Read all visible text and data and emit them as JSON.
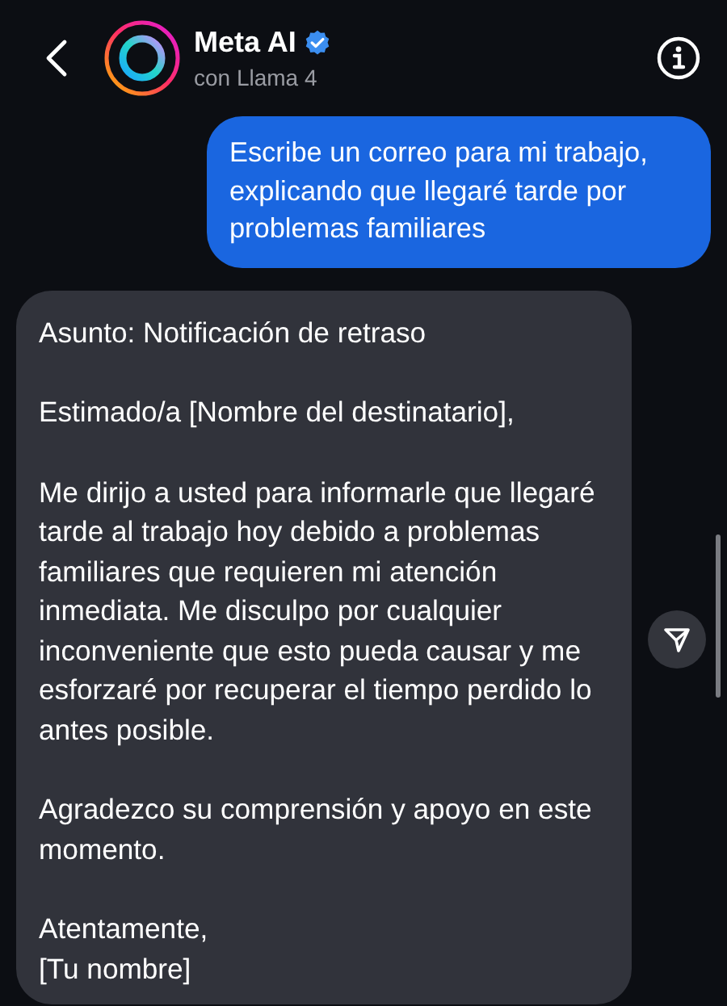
{
  "header": {
    "title": "Meta AI",
    "verified": true,
    "subtitle": "con Llama 4"
  },
  "messages": [
    {
      "kind": "user",
      "paragraphs": [
        "Escribe un correo para mi trabajo, explicando que llegaré tarde por problemas familiares"
      ]
    },
    {
      "kind": "ai",
      "paragraphs": [
        "Asunto: Notificación de retraso",
        "Estimado/a [Nombre del destinatario],",
        "Me dirijo a usted para informarle que llegaré tarde al trabajo hoy debido a problemas familiares que requieren mi atención inmediata. Me disculpo por cualquier inconveniente que esto pueda causar y me esforzaré por recuperar el tiempo perdido lo antes posible.",
        "Agradezco su comprensión y apoyo en este momento.",
        "Atentamente,\n[Tu nombre]"
      ]
    }
  ]
}
